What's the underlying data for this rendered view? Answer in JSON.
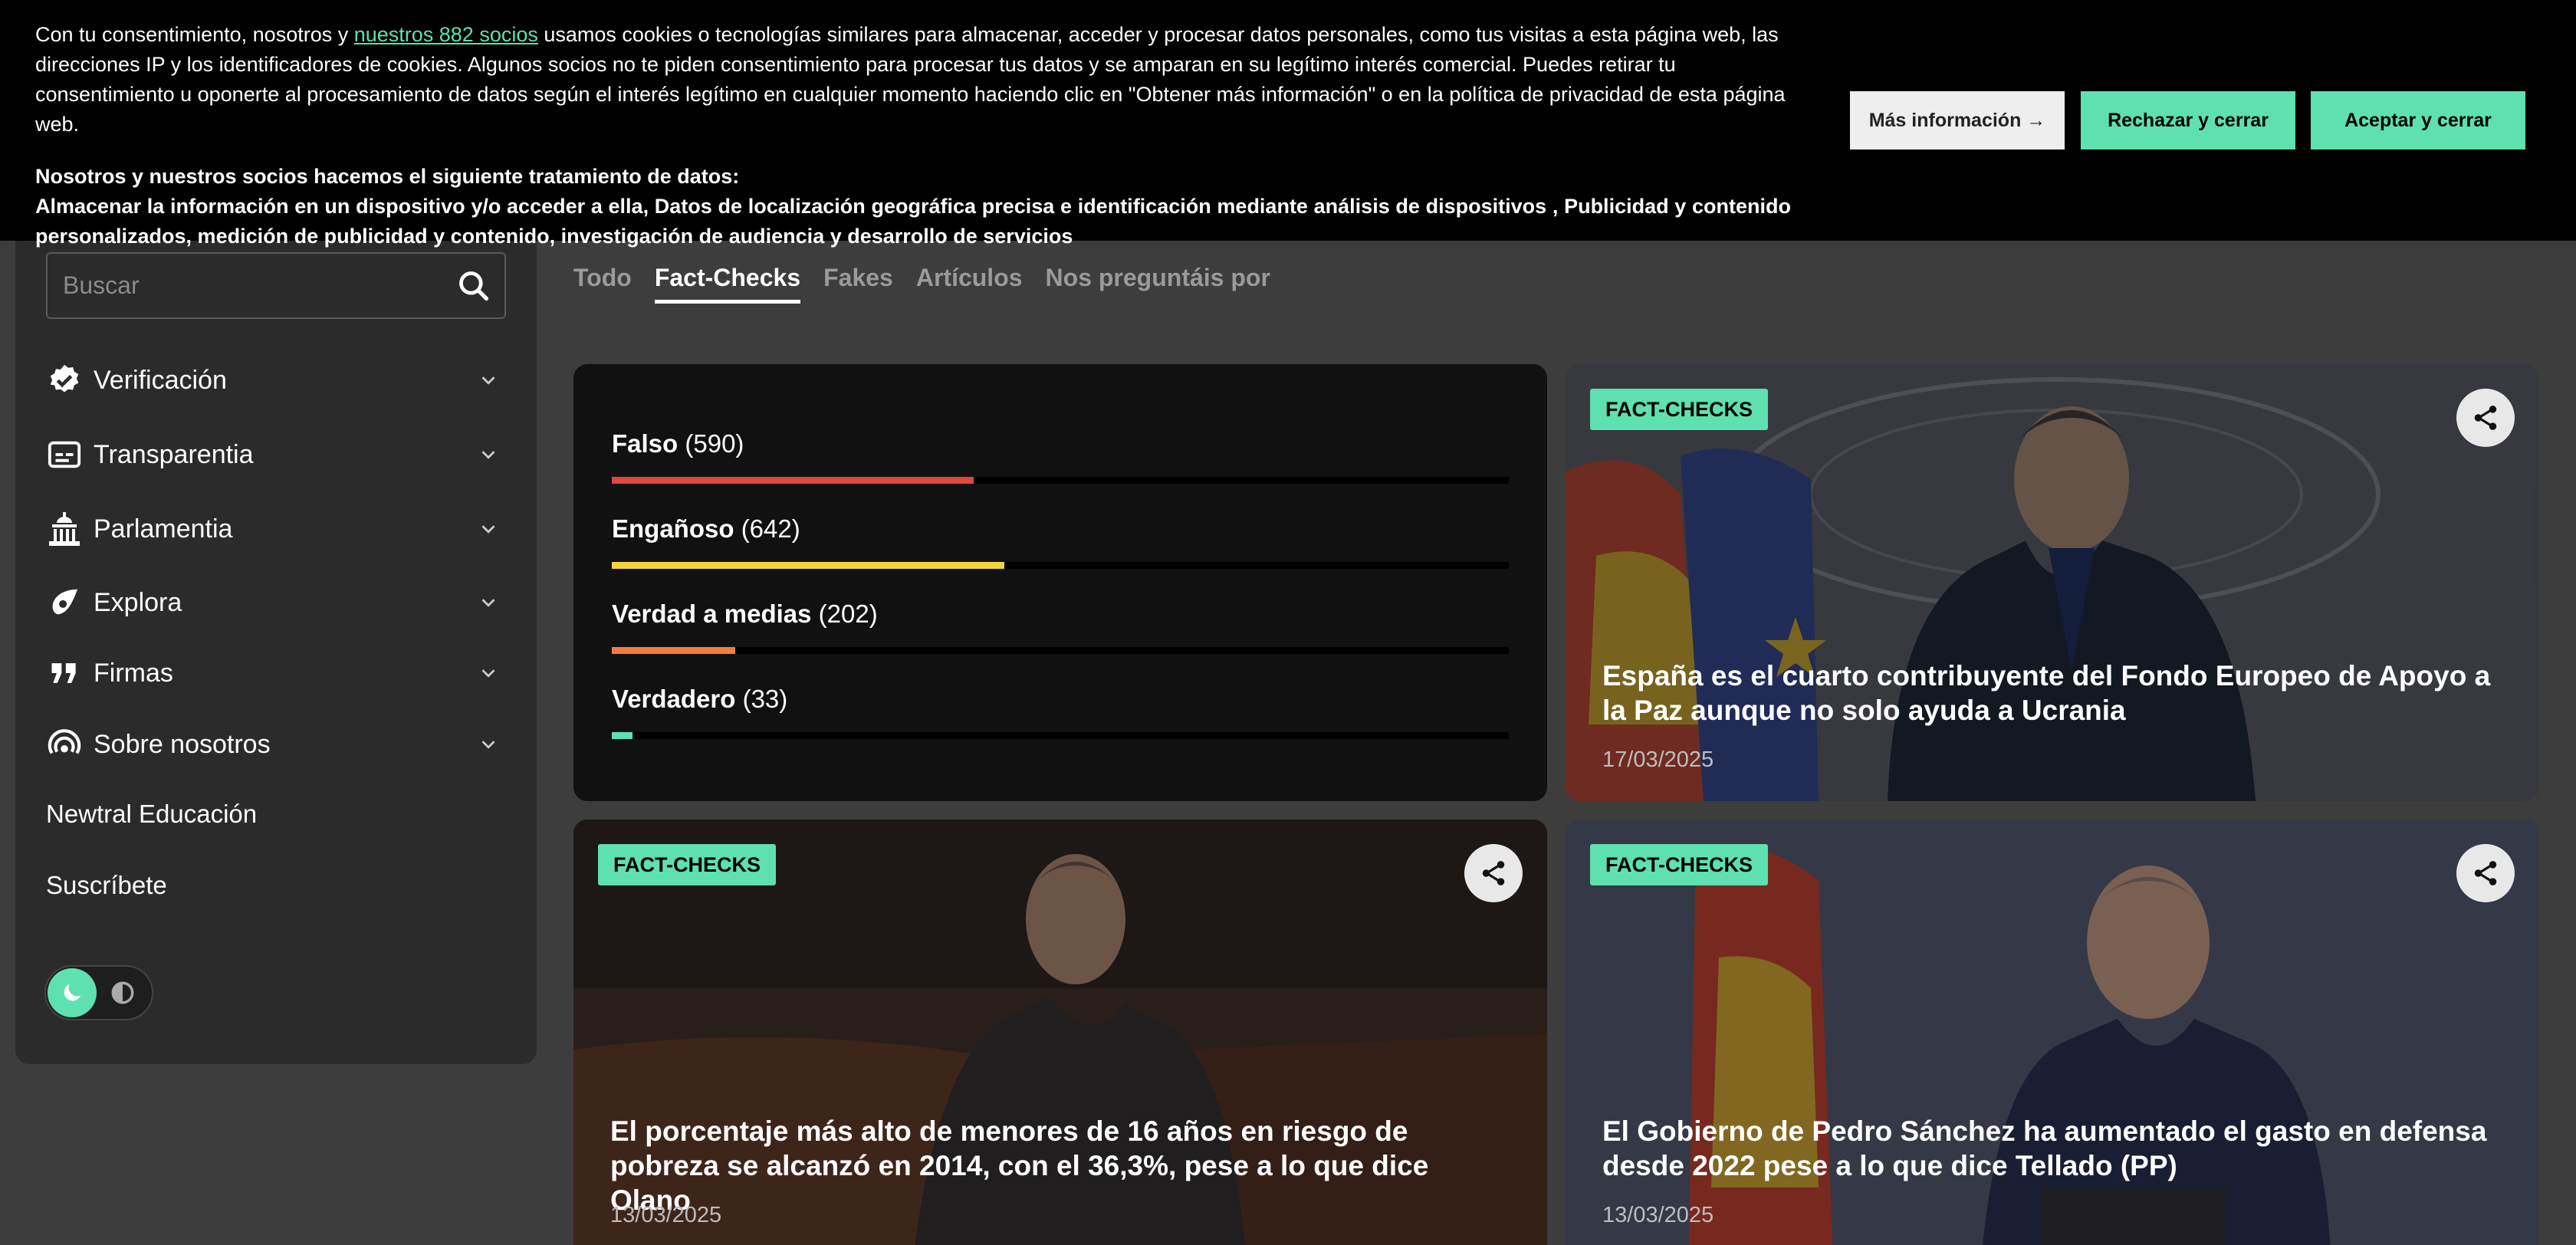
{
  "cookie_banner": {
    "text_before_link": "Con tu consentimiento, nosotros y ",
    "link_text": "nuestros 882 socios",
    "text_after_link": " usamos cookies o tecnologías similares para almacenar, acceder y procesar datos personales, como tus visitas a esta página web, las direcciones IP y los identificadores de cookies. Algunos socios no te piden consentimiento para procesar tus datos y se amparan en su legítimo interés comercial. Puedes retirar tu consentimiento u oponerte al procesamiento de datos según el interés legítimo en cualquier momento haciendo clic en \"Obtener más información\" o en la política de privacidad de esta página web.",
    "partners_title": "Nosotros y nuestros socios hacemos el siguiente tratamiento de datos:",
    "purposes": "Almacenar la información en un dispositivo y/o acceder a ella, Datos de localización geográfica precisa e identificación mediante análisis de dispositivos , Publicidad y contenido personalizados, medición de publicidad y contenido, investigación de audiencia y desarrollo de servicios",
    "more_info_label": "Más información →",
    "reject_label": "Rechazar y cerrar",
    "accept_label": "Aceptar y cerrar"
  },
  "sidebar": {
    "search_placeholder": "Buscar",
    "items": [
      {
        "label": "Verificación",
        "icon": "verified-badge-icon"
      },
      {
        "label": "Transparentia",
        "icon": "subtitles-icon"
      },
      {
        "label": "Parlamentia",
        "icon": "parliament-icon"
      },
      {
        "label": "Explora",
        "icon": "compass-icon"
      },
      {
        "label": "Firmas",
        "icon": "quote-icon"
      },
      {
        "label": "Sobre nosotros",
        "icon": "broadcast-icon"
      }
    ],
    "links": [
      "Newtral Educación",
      "Suscríbete"
    ]
  },
  "tabs": [
    "Todo",
    "Fact-Checks",
    "Fakes",
    "Artículos",
    "Nos preguntáis por"
  ],
  "active_tab": "Fact-Checks",
  "stats": [
    {
      "label": "Falso",
      "count": "(590)",
      "fraction": 0.403,
      "color": "#e0483d"
    },
    {
      "label": "Engañoso",
      "count": "(642)",
      "fraction": 0.438,
      "color": "#f2d43d"
    },
    {
      "label": "Verdad a medias",
      "count": "(202)",
      "fraction": 0.138,
      "color": "#f0803c"
    },
    {
      "label": "Verdadero",
      "count": "(33)",
      "fraction": 0.023,
      "color": "#5ee0b0"
    }
  ],
  "cards": [
    {
      "badge": "FACT-CHECKS",
      "title": "España es el cuarto contribuyente del Fondo Europeo de Apoyo a la Paz aunque no solo ayuda a Ucrania",
      "date": "17/03/2025"
    },
    {
      "badge": "FACT-CHECKS",
      "title": "El porcentaje más alto de menores de 16 años en riesgo de pobreza se alcanzó en 2014, con el 36,3%, pese a lo que dice Olano",
      "date": "13/03/2025"
    },
    {
      "badge": "FACT-CHECKS",
      "title": "El Gobierno de Pedro Sánchez ha aumentado el gasto en defensa desde 2022 pese a lo que dice Tellado (PP)",
      "date": "13/03/2025"
    }
  ],
  "colors": {
    "accent": "#5ee0b0",
    "banner_bg": "#000000",
    "page_bg": "#3d3d3d"
  }
}
